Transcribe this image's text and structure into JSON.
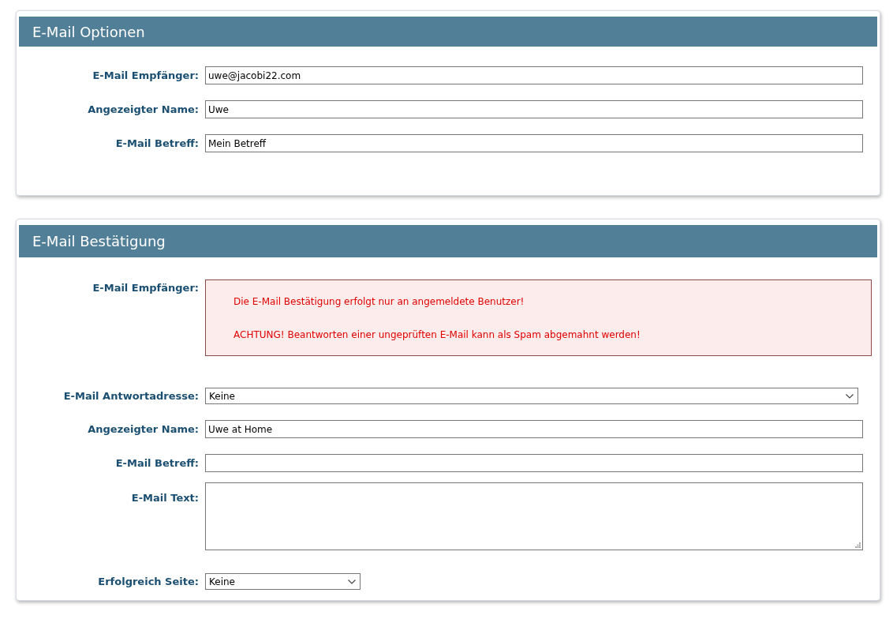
{
  "sections": [
    {
      "title": "E-Mail Optionen",
      "fields": [
        {
          "kind": "text",
          "label": "E-Mail Empfänger:",
          "value": "uwe@jacobi22.com"
        },
        {
          "kind": "text",
          "label": "Angezeigter Name:",
          "value": "Uwe"
        },
        {
          "kind": "text",
          "label": "E-Mail Betreff:",
          "value": "Mein Betreff"
        }
      ]
    },
    {
      "title": "E-Mail Bestätigung",
      "fields": [
        {
          "kind": "notice",
          "label": "E-Mail Empfänger:",
          "lines": [
            "Die E-Mail Bestätigung erfolgt nur an angemeldete Benutzer!",
            "ACHTUNG! Beantworten einer ungeprüften E-Mail kann als Spam abgemahnt werden!"
          ]
        },
        {
          "kind": "select",
          "label": "E-Mail Antwortadresse:",
          "value": "Keine"
        },
        {
          "kind": "text",
          "label": "Angezeigter Name:",
          "value": "Uwe at Home"
        },
        {
          "kind": "text",
          "label": "E-Mail Betreff:"
        },
        {
          "kind": "textarea",
          "label": "E-Mail Text:"
        },
        {
          "kind": "select",
          "label": "Erfolgreich Seite:",
          "value": "Keine"
        }
      ]
    }
  ]
}
